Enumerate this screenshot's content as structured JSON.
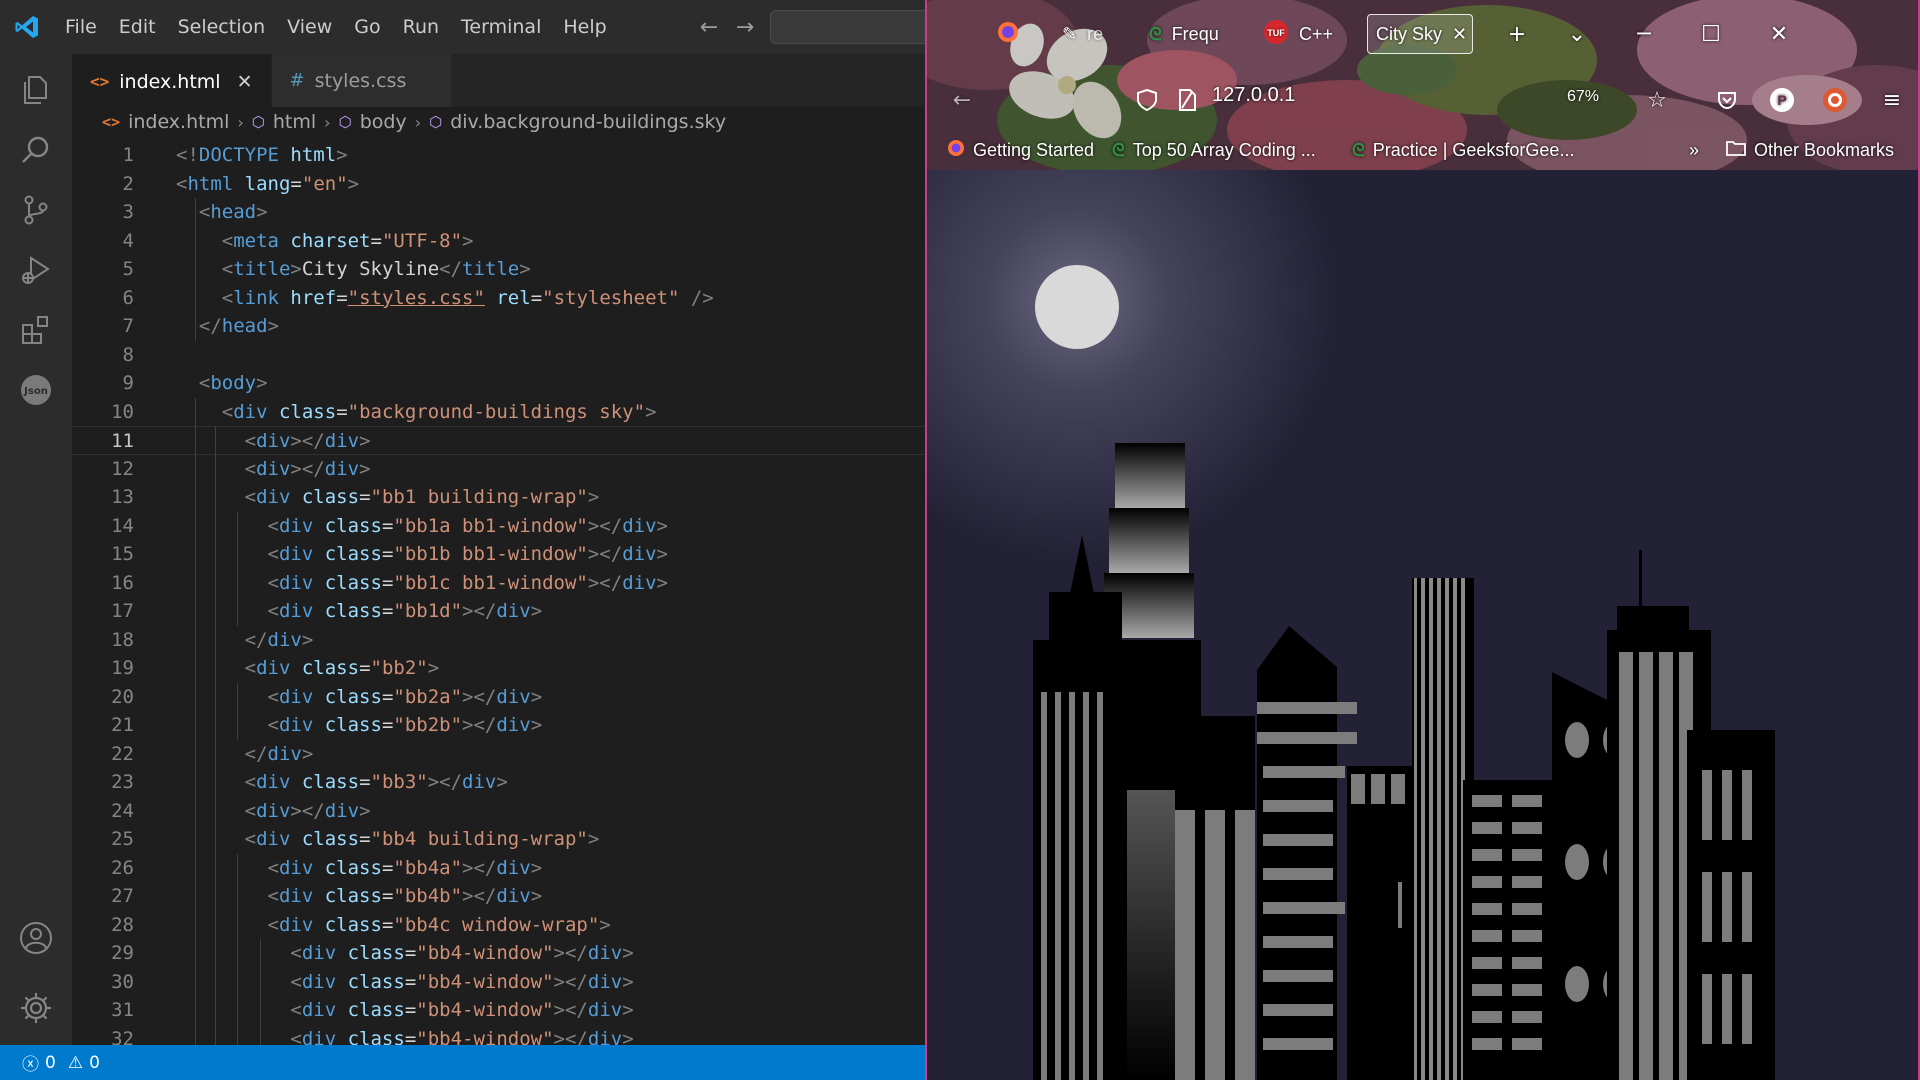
{
  "vscode": {
    "menu": [
      "File",
      "Edit",
      "Selection",
      "View",
      "Go",
      "Run",
      "Terminal",
      "Help"
    ],
    "tabs": [
      {
        "label": "index.html",
        "icon": "html-icon",
        "active": true
      },
      {
        "label": "styles.css",
        "icon": "css-icon",
        "active": false
      }
    ],
    "breadcrumb": [
      "index.html",
      "html",
      "body",
      "div.background-buildings.sky"
    ],
    "current_line": 11,
    "code_lines": [
      {
        "n": "1",
        "parts": [
          [
            "p",
            "<!"
          ],
          [
            "t",
            "DOCTYPE "
          ],
          [
            "a",
            "html"
          ],
          [
            "p",
            ">"
          ]
        ]
      },
      {
        "n": "2",
        "parts": [
          [
            "p",
            "<"
          ],
          [
            "t",
            "html"
          ],
          [
            "a",
            " lang"
          ],
          [
            "x",
            "="
          ],
          [
            "s",
            "\"en\""
          ],
          [
            "p",
            ">"
          ]
        ]
      },
      {
        "n": "3",
        "parts": [
          [
            "x",
            "  "
          ],
          [
            "p",
            "<"
          ],
          [
            "t",
            "head"
          ],
          [
            "p",
            ">"
          ]
        ]
      },
      {
        "n": "4",
        "parts": [
          [
            "x",
            "    "
          ],
          [
            "p",
            "<"
          ],
          [
            "t",
            "meta"
          ],
          [
            "a",
            " charset"
          ],
          [
            "x",
            "="
          ],
          [
            "s",
            "\"UTF-8\""
          ],
          [
            "p",
            ">"
          ]
        ]
      },
      {
        "n": "5",
        "parts": [
          [
            "x",
            "    "
          ],
          [
            "p",
            "<"
          ],
          [
            "t",
            "title"
          ],
          [
            "p",
            ">"
          ],
          [
            "x",
            "City Skyline"
          ],
          [
            "p",
            "</"
          ],
          [
            "t",
            "title"
          ],
          [
            "p",
            ">"
          ]
        ]
      },
      {
        "n": "6",
        "parts": [
          [
            "x",
            "    "
          ],
          [
            "p",
            "<"
          ],
          [
            "t",
            "link"
          ],
          [
            "a",
            " href"
          ],
          [
            "x",
            "="
          ],
          [
            "s",
            "\"styles.css\""
          ],
          [
            "a",
            " rel"
          ],
          [
            "x",
            "="
          ],
          [
            "s",
            "\"stylesheet\""
          ],
          [
            "p",
            " />"
          ]
        ]
      },
      {
        "n": "7",
        "parts": [
          [
            "x",
            "  "
          ],
          [
            "p",
            "</"
          ],
          [
            "t",
            "head"
          ],
          [
            "p",
            ">"
          ]
        ]
      },
      {
        "n": "8",
        "parts": []
      },
      {
        "n": "9",
        "parts": [
          [
            "x",
            "  "
          ],
          [
            "p",
            "<"
          ],
          [
            "t",
            "body"
          ],
          [
            "p",
            ">"
          ]
        ]
      },
      {
        "n": "10",
        "parts": [
          [
            "x",
            "    "
          ],
          [
            "p",
            "<"
          ],
          [
            "t",
            "div"
          ],
          [
            "a",
            " class"
          ],
          [
            "x",
            "="
          ],
          [
            "s",
            "\"background-buildings sky\""
          ],
          [
            "p",
            ">"
          ]
        ]
      },
      {
        "n": "11",
        "parts": [
          [
            "x",
            "      "
          ],
          [
            "p",
            "<"
          ],
          [
            "t",
            "div"
          ],
          [
            "p",
            "></"
          ],
          [
            "t",
            "div"
          ],
          [
            "p",
            ">"
          ]
        ]
      },
      {
        "n": "12",
        "parts": [
          [
            "x",
            "      "
          ],
          [
            "p",
            "<"
          ],
          [
            "t",
            "div"
          ],
          [
            "p",
            "></"
          ],
          [
            "t",
            "div"
          ],
          [
            "p",
            ">"
          ]
        ]
      },
      {
        "n": "13",
        "parts": [
          [
            "x",
            "      "
          ],
          [
            "p",
            "<"
          ],
          [
            "t",
            "div"
          ],
          [
            "a",
            " class"
          ],
          [
            "x",
            "="
          ],
          [
            "s",
            "\"bb1 building-wrap\""
          ],
          [
            "p",
            ">"
          ]
        ]
      },
      {
        "n": "14",
        "parts": [
          [
            "x",
            "        "
          ],
          [
            "p",
            "<"
          ],
          [
            "t",
            "div"
          ],
          [
            "a",
            " class"
          ],
          [
            "x",
            "="
          ],
          [
            "s",
            "\"bb1a bb1-window\""
          ],
          [
            "p",
            "></"
          ],
          [
            "t",
            "div"
          ],
          [
            "p",
            ">"
          ]
        ]
      },
      {
        "n": "15",
        "parts": [
          [
            "x",
            "        "
          ],
          [
            "p",
            "<"
          ],
          [
            "t",
            "div"
          ],
          [
            "a",
            " class"
          ],
          [
            "x",
            "="
          ],
          [
            "s",
            "\"bb1b bb1-window\""
          ],
          [
            "p",
            "></"
          ],
          [
            "t",
            "div"
          ],
          [
            "p",
            ">"
          ]
        ]
      },
      {
        "n": "16",
        "parts": [
          [
            "x",
            "        "
          ],
          [
            "p",
            "<"
          ],
          [
            "t",
            "div"
          ],
          [
            "a",
            " class"
          ],
          [
            "x",
            "="
          ],
          [
            "s",
            "\"bb1c bb1-window\""
          ],
          [
            "p",
            "></"
          ],
          [
            "t",
            "div"
          ],
          [
            "p",
            ">"
          ]
        ]
      },
      {
        "n": "17",
        "parts": [
          [
            "x",
            "        "
          ],
          [
            "p",
            "<"
          ],
          [
            "t",
            "div"
          ],
          [
            "a",
            " class"
          ],
          [
            "x",
            "="
          ],
          [
            "s",
            "\"bb1d\""
          ],
          [
            "p",
            "></"
          ],
          [
            "t",
            "div"
          ],
          [
            "p",
            ">"
          ]
        ]
      },
      {
        "n": "18",
        "parts": [
          [
            "x",
            "      "
          ],
          [
            "p",
            "</"
          ],
          [
            "t",
            "div"
          ],
          [
            "p",
            ">"
          ]
        ]
      },
      {
        "n": "19",
        "parts": [
          [
            "x",
            "      "
          ],
          [
            "p",
            "<"
          ],
          [
            "t",
            "div"
          ],
          [
            "a",
            " class"
          ],
          [
            "x",
            "="
          ],
          [
            "s",
            "\"bb2\""
          ],
          [
            "p",
            ">"
          ]
        ]
      },
      {
        "n": "20",
        "parts": [
          [
            "x",
            "        "
          ],
          [
            "p",
            "<"
          ],
          [
            "t",
            "div"
          ],
          [
            "a",
            " class"
          ],
          [
            "x",
            "="
          ],
          [
            "s",
            "\"bb2a\""
          ],
          [
            "p",
            "></"
          ],
          [
            "t",
            "div"
          ],
          [
            "p",
            ">"
          ]
        ]
      },
      {
        "n": "21",
        "parts": [
          [
            "x",
            "        "
          ],
          [
            "p",
            "<"
          ],
          [
            "t",
            "div"
          ],
          [
            "a",
            " class"
          ],
          [
            "x",
            "="
          ],
          [
            "s",
            "\"bb2b\""
          ],
          [
            "p",
            "></"
          ],
          [
            "t",
            "div"
          ],
          [
            "p",
            ">"
          ]
        ]
      },
      {
        "n": "22",
        "parts": [
          [
            "x",
            "      "
          ],
          [
            "p",
            "</"
          ],
          [
            "t",
            "div"
          ],
          [
            "p",
            ">"
          ]
        ]
      },
      {
        "n": "23",
        "parts": [
          [
            "x",
            "      "
          ],
          [
            "p",
            "<"
          ],
          [
            "t",
            "div"
          ],
          [
            "a",
            " class"
          ],
          [
            "x",
            "="
          ],
          [
            "s",
            "\"bb3\""
          ],
          [
            "p",
            "></"
          ],
          [
            "t",
            "div"
          ],
          [
            "p",
            ">"
          ]
        ]
      },
      {
        "n": "24",
        "parts": [
          [
            "x",
            "      "
          ],
          [
            "p",
            "<"
          ],
          [
            "t",
            "div"
          ],
          [
            "p",
            "></"
          ],
          [
            "t",
            "div"
          ],
          [
            "p",
            ">"
          ]
        ]
      },
      {
        "n": "25",
        "parts": [
          [
            "x",
            "      "
          ],
          [
            "p",
            "<"
          ],
          [
            "t",
            "div"
          ],
          [
            "a",
            " class"
          ],
          [
            "x",
            "="
          ],
          [
            "s",
            "\"bb4 building-wrap\""
          ],
          [
            "p",
            ">"
          ]
        ]
      },
      {
        "n": "26",
        "parts": [
          [
            "x",
            "        "
          ],
          [
            "p",
            "<"
          ],
          [
            "t",
            "div"
          ],
          [
            "a",
            " class"
          ],
          [
            "x",
            "="
          ],
          [
            "s",
            "\"bb4a\""
          ],
          [
            "p",
            "></"
          ],
          [
            "t",
            "div"
          ],
          [
            "p",
            ">"
          ]
        ]
      },
      {
        "n": "27",
        "parts": [
          [
            "x",
            "        "
          ],
          [
            "p",
            "<"
          ],
          [
            "t",
            "div"
          ],
          [
            "a",
            " class"
          ],
          [
            "x",
            "="
          ],
          [
            "s",
            "\"bb4b\""
          ],
          [
            "p",
            "></"
          ],
          [
            "t",
            "div"
          ],
          [
            "p",
            ">"
          ]
        ]
      },
      {
        "n": "28",
        "parts": [
          [
            "x",
            "        "
          ],
          [
            "p",
            "<"
          ],
          [
            "t",
            "div"
          ],
          [
            "a",
            " class"
          ],
          [
            "x",
            "="
          ],
          [
            "s",
            "\"bb4c window-wrap\""
          ],
          [
            "p",
            ">"
          ]
        ]
      },
      {
        "n": "29",
        "parts": [
          [
            "x",
            "          "
          ],
          [
            "p",
            "<"
          ],
          [
            "t",
            "div"
          ],
          [
            "a",
            " class"
          ],
          [
            "x",
            "="
          ],
          [
            "s",
            "\"bb4-window\""
          ],
          [
            "p",
            "></"
          ],
          [
            "t",
            "div"
          ],
          [
            "p",
            ">"
          ]
        ]
      },
      {
        "n": "30",
        "parts": [
          [
            "x",
            "          "
          ],
          [
            "p",
            "<"
          ],
          [
            "t",
            "div"
          ],
          [
            "a",
            " class"
          ],
          [
            "x",
            "="
          ],
          [
            "s",
            "\"bb4-window\""
          ],
          [
            "p",
            "></"
          ],
          [
            "t",
            "div"
          ],
          [
            "p",
            ">"
          ]
        ]
      },
      {
        "n": "31",
        "parts": [
          [
            "x",
            "          "
          ],
          [
            "p",
            "<"
          ],
          [
            "t",
            "div"
          ],
          [
            "a",
            " class"
          ],
          [
            "x",
            "="
          ],
          [
            "s",
            "\"bb4-window\""
          ],
          [
            "p",
            "></"
          ],
          [
            "t",
            "div"
          ],
          [
            "p",
            ">"
          ]
        ]
      },
      {
        "n": "32",
        "parts": [
          [
            "x",
            "          "
          ],
          [
            "p",
            "<"
          ],
          [
            "t",
            "div"
          ],
          [
            "a",
            " class"
          ],
          [
            "x",
            "="
          ],
          [
            "s",
            "\"bb4-window\""
          ],
          [
            "p",
            "></"
          ],
          [
            "t",
            "div"
          ],
          [
            "p",
            ">"
          ]
        ]
      }
    ],
    "status": {
      "errors": "0",
      "warnings": "0"
    },
    "colors": {
      "accent": "#007acc",
      "tag": "#569cd6",
      "attr": "#9cdcfe",
      "string": "#ce9178"
    }
  },
  "firefox": {
    "tabs": [
      {
        "label": "",
        "favicon": "firefox-icon"
      },
      {
        "label": "re",
        "favicon": "pen-icon"
      },
      {
        "label": "Frequ",
        "favicon": "gfg-icon"
      },
      {
        "label": "C++",
        "favicon": "tuf-icon"
      },
      {
        "label": "City Sky",
        "favicon": "",
        "active": true
      }
    ],
    "new_tab": "+",
    "url": "127.0.0.1",
    "zoom": "67%",
    "bookmarks": [
      {
        "label": "Getting Started",
        "icon": "firefox-icon"
      },
      {
        "label": "Top 50 Array Coding ...",
        "icon": "gfg-icon"
      },
      {
        "label": "Practice | GeeksforGee...",
        "icon": "gfg-icon"
      }
    ],
    "other_bookmarks": "Other Bookmarks",
    "page_title": "City Skyline"
  }
}
